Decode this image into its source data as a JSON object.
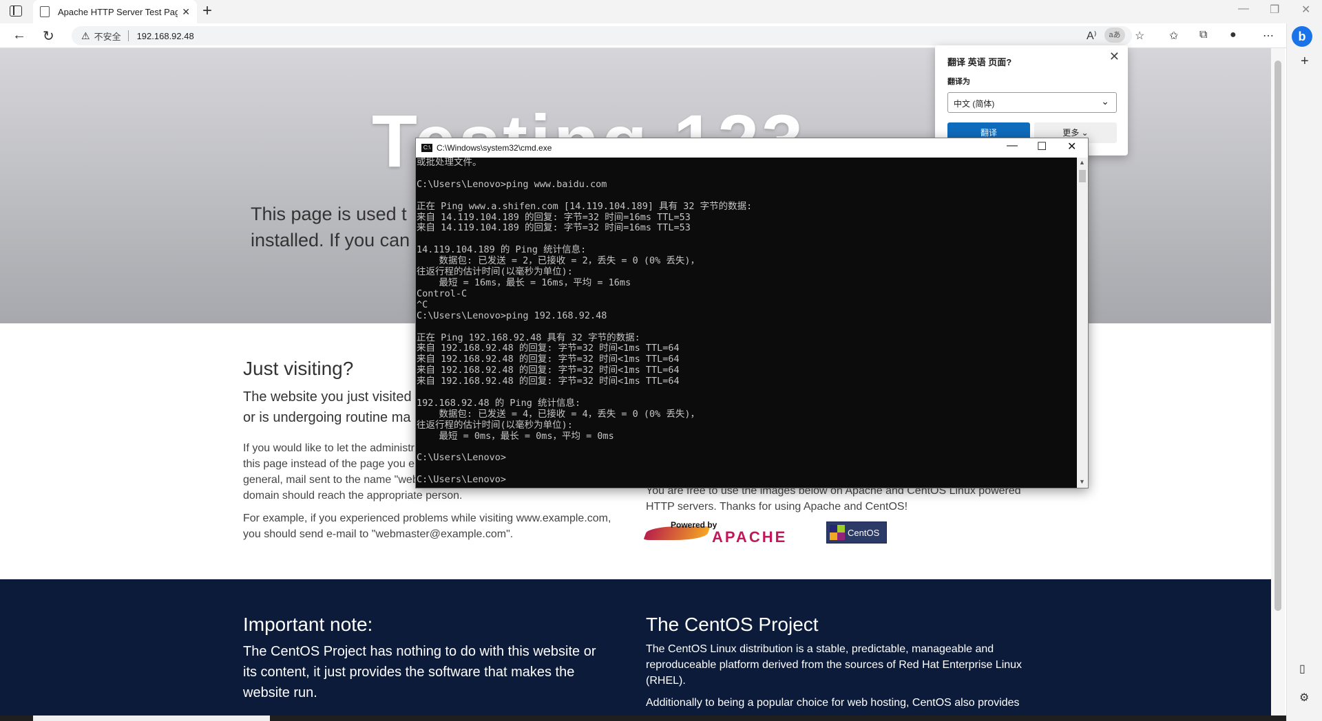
{
  "browser": {
    "tab_title": "Apache HTTP Server Test Page p",
    "url_warning": "不安全",
    "url": "192.168.92.48",
    "translate_icon": "aあ"
  },
  "translate_popup": {
    "title": "翻译 英语 页面?",
    "to_label": "翻译为",
    "language": "中文 (简体)",
    "translate_button": "翻译",
    "more_button": "更多"
  },
  "page": {
    "hero_title": "Testing 123",
    "hero_text": "This page is used t\ninstalled. If you can",
    "just_visiting_title": "Just visiting?",
    "just_visiting_lead": "The website you just visited\nor is undergoing routine ma",
    "just_visiting_p1": "If you would like to let the administr\nthis page instead of the page you e\ngeneral, mail sent to the name \"web\ndomain should reach the appropriate person.",
    "just_visiting_p2": "For example, if you experienced problems while visiting www.example.com,\nyou should send e-mail to \"webmaster@example.com\".",
    "free_images": "You are free to use the images below on Apache and CentOS Linux powered\nHTTP servers. Thanks for using Apache and CentOS!",
    "apache_powered": "Powered by",
    "apache_name": "APACHE",
    "centos_logo": "CentOS",
    "important_title": "Important note:",
    "important_text": "The CentOS Project has nothing to do with this website or\nits content, it just provides the software that makes the\nwebsite run.",
    "centos_title": "The CentOS Project",
    "centos_p1": "The CentOS Linux distribution is a stable, predictable, manageable and\nreproduceable platform derived from the sources of Red Hat Enterprise Linux\n(RHEL).",
    "centos_p2": "Additionally to being a popular choice for web hosting, CentOS also provides"
  },
  "cmd": {
    "title": "C:\\Windows\\system32\\cmd.exe",
    "output": "或批处理文件。\n\nC:\\Users\\Lenovo>ping www.baidu.com\n\n正在 Ping www.a.shifen.com [14.119.104.189] 具有 32 字节的数据:\n来自 14.119.104.189 的回复: 字节=32 时间=16ms TTL=53\n来自 14.119.104.189 的回复: 字节=32 时间=16ms TTL=53\n\n14.119.104.189 的 Ping 统计信息:\n    数据包: 已发送 = 2，已接收 = 2，丢失 = 0 (0% 丢失)，\n往返行程的估计时间(以毫秒为单位):\n    最短 = 16ms，最长 = 16ms，平均 = 16ms\nControl-C\n^C\nC:\\Users\\Lenovo>ping 192.168.92.48\n\n正在 Ping 192.168.92.48 具有 32 字节的数据:\n来自 192.168.92.48 的回复: 字节=32 时间<1ms TTL=64\n来自 192.168.92.48 的回复: 字节=32 时间<1ms TTL=64\n来自 192.168.92.48 的回复: 字节=32 时间<1ms TTL=64\n来自 192.168.92.48 的回复: 字节=32 时间<1ms TTL=64\n\n192.168.92.48 的 Ping 统计信息:\n    数据包: 已发送 = 4，已接收 = 4，丢失 = 0 (0% 丢失)，\n往返行程的估计时间(以毫秒为单位):\n    最短 = 0ms，最长 = 0ms，平均 = 0ms\n\nC:\\Users\\Lenovo>\n\nC:\\Users\\Lenovo>"
  }
}
